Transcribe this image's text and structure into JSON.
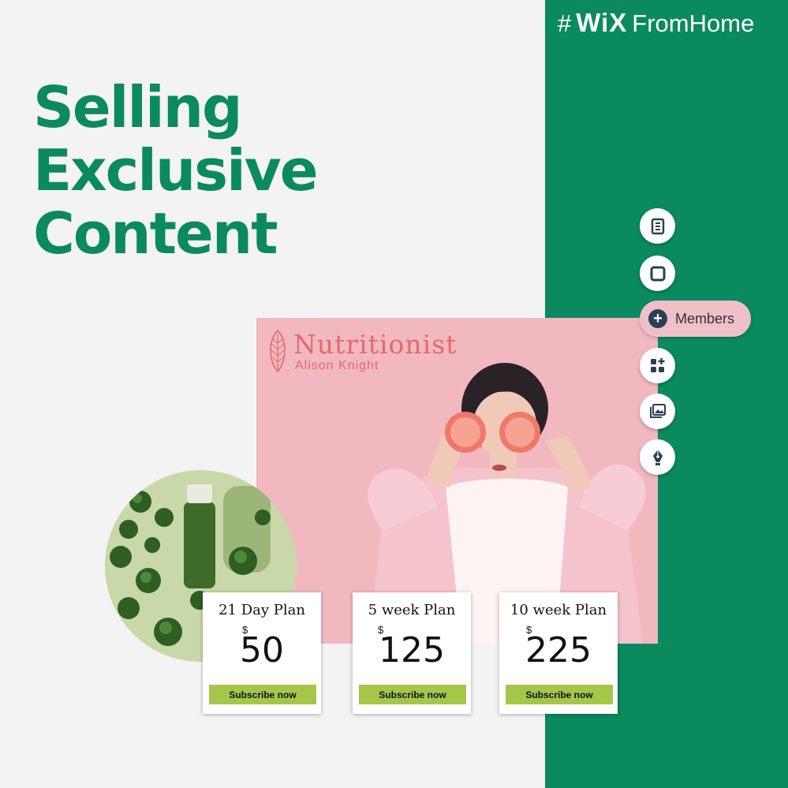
{
  "brand": {
    "hash": "#",
    "wix": "WiX",
    "rest": "FromHome"
  },
  "headline": {
    "line1": "Selling Exclusive",
    "line2": "Content"
  },
  "hero": {
    "title": "Nutritionist",
    "subtitle": "Alison Knight"
  },
  "toolbar": {
    "members_label": "Members",
    "members_plus": "+",
    "icons": [
      "page-icon",
      "square-icon",
      "members-plus-icon",
      "add-apps-icon",
      "media-icon",
      "pen-icon"
    ]
  },
  "plans": [
    {
      "name": "21 Day Plan",
      "currency": "$",
      "price": "50",
      "button": "Subscribe now"
    },
    {
      "name": "5 week Plan",
      "currency": "$",
      "price": "125",
      "button": "Subscribe now"
    },
    {
      "name": "10 week Plan",
      "currency": "$",
      "price": "225",
      "button": "Subscribe now"
    }
  ],
  "colors": {
    "brand_green": "#0b8a5e",
    "hero_pink": "#f2b8c0",
    "accent_coral": "#e36a6a",
    "subscribe_green": "#a6c64a",
    "background": "#f3f3f3"
  }
}
